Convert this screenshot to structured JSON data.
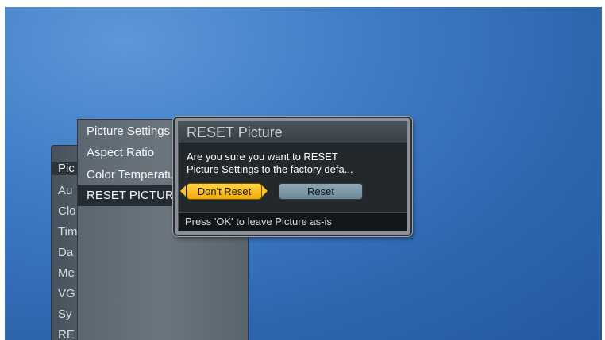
{
  "back_menu": {
    "items": [
      "Pic",
      "Au",
      "Clo",
      "Tim",
      "Da",
      "Me",
      "VG",
      "Sy",
      "RE"
    ],
    "selected_index": 0
  },
  "front_menu": {
    "items": [
      "Picture Settings",
      "Aspect Ratio",
      "Color Temperature",
      "RESET PICTURE"
    ],
    "selected_index": 3
  },
  "dialog": {
    "title": "RESET Picture",
    "message_line1": "Are you sure you want to RESET",
    "message_line2": "Picture Settings to the factory defa...",
    "dont_reset_label": "Don't Reset",
    "reset_label": "Reset",
    "footer_hint": "Press 'OK' to leave Picture as-is"
  },
  "colors": {
    "background": "#3f7dc6",
    "selected_button": "#f5c12c",
    "secondary_button": "#7d97a5"
  }
}
